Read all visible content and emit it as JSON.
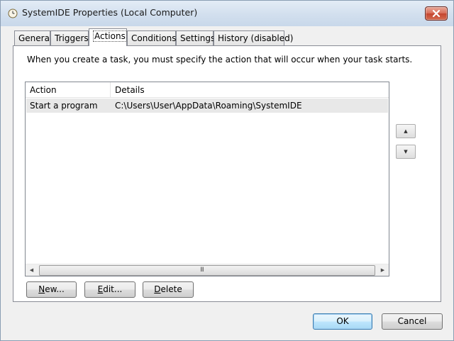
{
  "window": {
    "title": "SystemIDE Properties (Local Computer)"
  },
  "tabs": [
    {
      "label": "General"
    },
    {
      "label": "Triggers"
    },
    {
      "label": "Actions"
    },
    {
      "label": "Conditions"
    },
    {
      "label": "Settings"
    },
    {
      "label": "History (disabled)"
    }
  ],
  "actions_tab": {
    "description": "When you create a task, you must specify the action that will occur when your task starts.",
    "columns": {
      "action": "Action",
      "details": "Details"
    },
    "rows": [
      {
        "action": "Start a program",
        "details": "C:\\Users\\User\\AppData\\Roaming\\SystemIDE"
      }
    ],
    "scroll_grip": "III",
    "buttons": {
      "new": {
        "mnemonic": "N",
        "rest": "ew..."
      },
      "edit": {
        "mnemonic": "E",
        "rest": "dit..."
      },
      "delete": {
        "mnemonic": "D",
        "rest": "elete"
      }
    }
  },
  "footer": {
    "ok": "OK",
    "cancel": "Cancel"
  },
  "icons": {
    "title": "clock-icon",
    "close": "close-icon",
    "move_up": "arrow-up-icon",
    "move_down": "arrow-down-icon",
    "scroll_left": "scroll-left-icon",
    "scroll_right": "scroll-right-icon"
  }
}
